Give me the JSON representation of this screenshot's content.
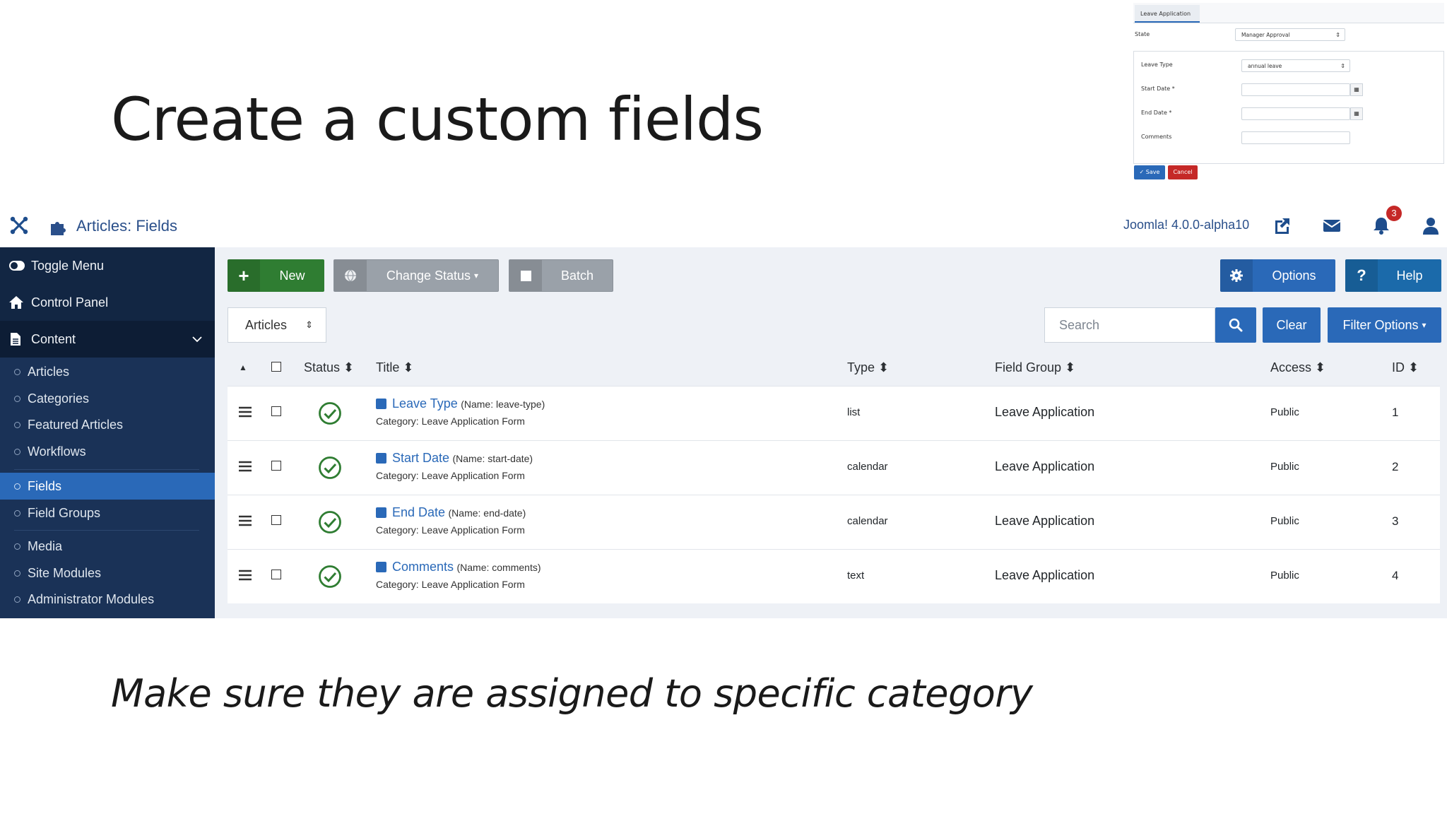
{
  "slide": {
    "title": "Create a custom fields",
    "subtitle": "Make sure they are assigned to specific category"
  },
  "inset": {
    "tab": "Leave Application",
    "state_label": "State",
    "state_value": "Manager Approval",
    "leave_type_label": "Leave Type",
    "leave_type_value": "annual leave",
    "start_date_label": "Start Date *",
    "end_date_label": "End Date *",
    "comments_label": "Comments",
    "save": "Save",
    "cancel": "Cancel"
  },
  "header": {
    "title": "Articles: Fields",
    "version": "Joomla! 4.0.0-alpha10",
    "notification_count": "3"
  },
  "sidebar": {
    "toggle": "Toggle Menu",
    "control_panel": "Control Panel",
    "content": "Content",
    "items": [
      "Articles",
      "Categories",
      "Featured Articles",
      "Workflows",
      "Fields",
      "Field Groups",
      "Media",
      "Site Modules",
      "Administrator Modules"
    ]
  },
  "toolbar": {
    "new": "New",
    "change_status": "Change Status",
    "batch": "Batch",
    "options": "Options",
    "help": "Help"
  },
  "filters": {
    "context": "Articles",
    "search_placeholder": "Search",
    "clear": "Clear",
    "filter_options": "Filter Options"
  },
  "table": {
    "headers": {
      "status": "Status",
      "title": "Title",
      "type": "Type",
      "field_group": "Field Group",
      "access": "Access",
      "id": "ID"
    },
    "rows": [
      {
        "title": "Leave Type",
        "name": "(Name: leave-type)",
        "category": "Category: Leave Application Form",
        "type": "list",
        "group": "Leave Application",
        "access": "Public",
        "id": "1"
      },
      {
        "title": "Start Date",
        "name": "(Name: start-date)",
        "category": "Category: Leave Application Form",
        "type": "calendar",
        "group": "Leave Application",
        "access": "Public",
        "id": "2"
      },
      {
        "title": "End Date",
        "name": "(Name: end-date)",
        "category": "Category: Leave Application Form",
        "type": "calendar",
        "group": "Leave Application",
        "access": "Public",
        "id": "3"
      },
      {
        "title": "Comments",
        "name": "(Name: comments)",
        "category": "Category: Leave Application Form",
        "type": "text",
        "group": "Leave Application",
        "access": "Public",
        "id": "4"
      }
    ]
  },
  "colors": {
    "sidebar": "#122643",
    "primary": "#2a69b8",
    "success": "#2f7d32",
    "danger": "#c52827"
  }
}
